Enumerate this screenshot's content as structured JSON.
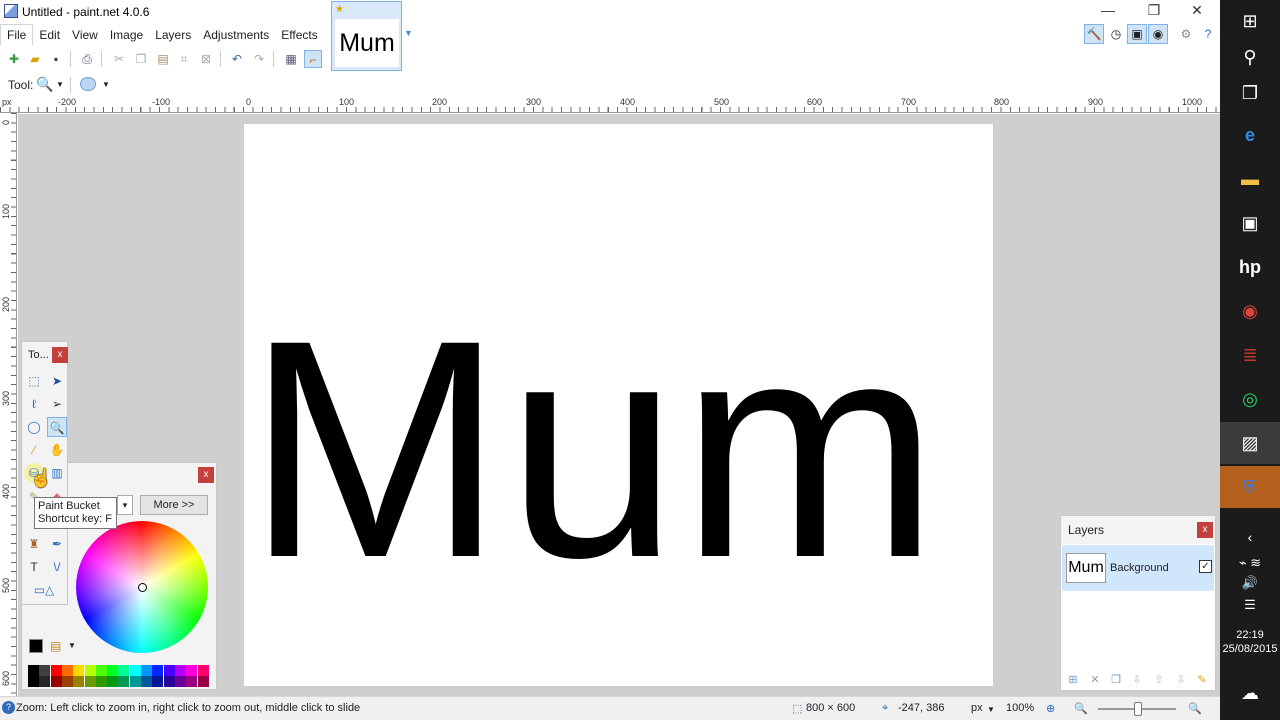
{
  "window": {
    "title": "Untitled - paint.net 4.0.6",
    "minimize": "—",
    "restore": "❐",
    "close": "✕"
  },
  "menu": [
    "File",
    "Edit",
    "View",
    "Image",
    "Layers",
    "Adjustments",
    "Effects"
  ],
  "image_tab": {
    "thumb_text": "Mum",
    "star": "★",
    "dropdown": "▼"
  },
  "toolbar2": {
    "tool_label": "Tool:"
  },
  "rulers": {
    "unit": "px",
    "h_labels": [
      "-200",
      "-100",
      "0",
      "100",
      "200",
      "300",
      "400",
      "500",
      "600",
      "700",
      "800",
      "900",
      "1000"
    ],
    "v_labels": [
      "0",
      "100",
      "200",
      "300",
      "400",
      "500",
      "600"
    ]
  },
  "canvas": {
    "text": "Mum"
  },
  "tools_window": {
    "title": "To...",
    "close": "x"
  },
  "colors_window": {
    "close": "x",
    "more_button": "More >>",
    "dropdown": "▾"
  },
  "tooltip": {
    "line1": "Paint Bucket",
    "line2": "Shortcut key: F"
  },
  "layers_window": {
    "title": "Layers",
    "close": "x",
    "layer": {
      "thumb": "Mum",
      "name": "Background",
      "visible_check": "✓"
    }
  },
  "status": {
    "hint": "Zoom: Left click to zoom in, right click to zoom out, middle click to slide",
    "image_size": "800 × 600",
    "cursor_pos": "-247, 386",
    "units": "px",
    "zoom": "100%"
  },
  "taskbar": {
    "time": "22:19",
    "date": "25/08/2015"
  },
  "colors": {
    "accent": "#2d6bbd",
    "close_red": "#c4403a",
    "tab_blue": "#d9e9f9",
    "workspace": "#cfcfcf",
    "taskbar": "#1b1b1b",
    "palette": [
      "#000000",
      "#404040",
      "#ff0000",
      "#ff6a00",
      "#ffd800",
      "#b6ff00",
      "#4cff00",
      "#00ff21",
      "#00ff90",
      "#00ffff",
      "#0094ff",
      "#0026ff",
      "#4800ff",
      "#b200ff",
      "#ff00dc",
      "#ff006e"
    ]
  }
}
